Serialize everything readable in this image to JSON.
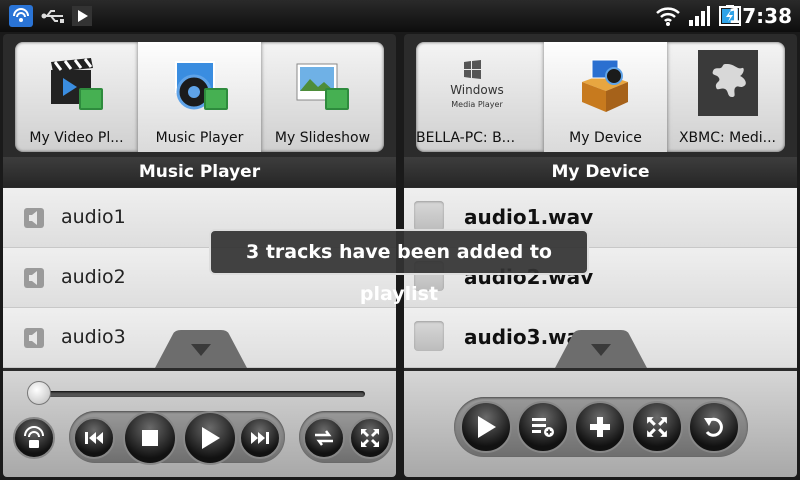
{
  "status_bar": {
    "time": "17:38",
    "icons": [
      "wifi-tether-icon",
      "usb-icon",
      "play-icon",
      "wifi-icon",
      "signal-icon",
      "battery-icon"
    ]
  },
  "left_panel": {
    "title": "Music Player",
    "carousel": [
      {
        "label": "My Video Pl...",
        "icon": "video-folder-icon"
      },
      {
        "label": "Music Player",
        "icon": "music-folder-icon",
        "selected": true
      },
      {
        "label": "My Slideshow",
        "icon": "slideshow-folder-icon"
      }
    ],
    "tracks": [
      {
        "label": "audio1"
      },
      {
        "label": "audio2"
      },
      {
        "label": "audio3"
      }
    ]
  },
  "right_panel": {
    "title": "My Device",
    "carousel": [
      {
        "label": "BELLA-PC: B...",
        "icon": "windows-media-player-icon",
        "logo_text": "Windows",
        "logo_subtext": "Media Player"
      },
      {
        "label": "My Device",
        "icon": "my-device-icon",
        "selected": true
      },
      {
        "label": "XBMC: Medi...",
        "icon": "xbmc-icon"
      }
    ],
    "files": [
      {
        "label": "audio1.wav"
      },
      {
        "label": "audio2.wav"
      },
      {
        "label": "audio3.wav"
      }
    ]
  },
  "player": {
    "progress": 0
  },
  "toast": {
    "message": "3 tracks have been added to playlist"
  },
  "colors": {
    "panel_bg": "#2b2b2b",
    "list_bg": "#e6e6e6",
    "toast_bg": "#323232"
  }
}
